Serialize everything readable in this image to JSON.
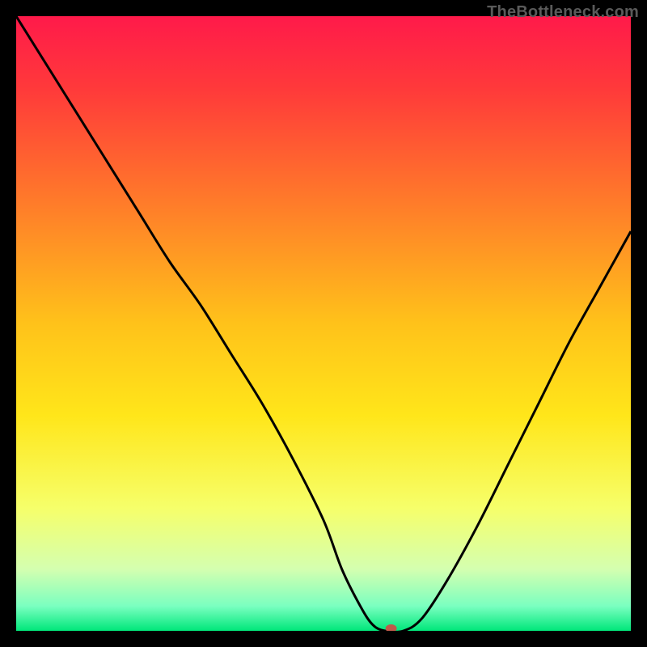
{
  "watermark": "TheBottleneck.com",
  "chart_data": {
    "type": "line",
    "title": "",
    "xlabel": "",
    "ylabel": "",
    "xlim": [
      0,
      100
    ],
    "ylim": [
      0,
      100
    ],
    "gradient_stops": [
      {
        "offset": 0,
        "color": "#ff1a4a"
      },
      {
        "offset": 12,
        "color": "#ff3a3a"
      },
      {
        "offset": 30,
        "color": "#ff7a2a"
      },
      {
        "offset": 50,
        "color": "#ffc21a"
      },
      {
        "offset": 65,
        "color": "#ffe61a"
      },
      {
        "offset": 80,
        "color": "#f6ff6a"
      },
      {
        "offset": 90,
        "color": "#d4ffb0"
      },
      {
        "offset": 96,
        "color": "#7affc0"
      },
      {
        "offset": 100,
        "color": "#00e77a"
      }
    ],
    "series": [
      {
        "name": "bottleneck-curve",
        "x": [
          0,
          5,
          10,
          15,
          20,
          25,
          30,
          35,
          40,
          45,
          50,
          53,
          56,
          58,
          60,
          63,
          66,
          70,
          75,
          80,
          85,
          90,
          95,
          100
        ],
        "values": [
          100,
          92,
          84,
          76,
          68,
          60,
          53,
          45,
          37,
          28,
          18,
          10,
          4,
          1,
          0,
          0,
          2,
          8,
          17,
          27,
          37,
          47,
          56,
          65
        ]
      }
    ],
    "marker": {
      "x": 61,
      "y": 0,
      "color": "#c05a4a"
    }
  }
}
